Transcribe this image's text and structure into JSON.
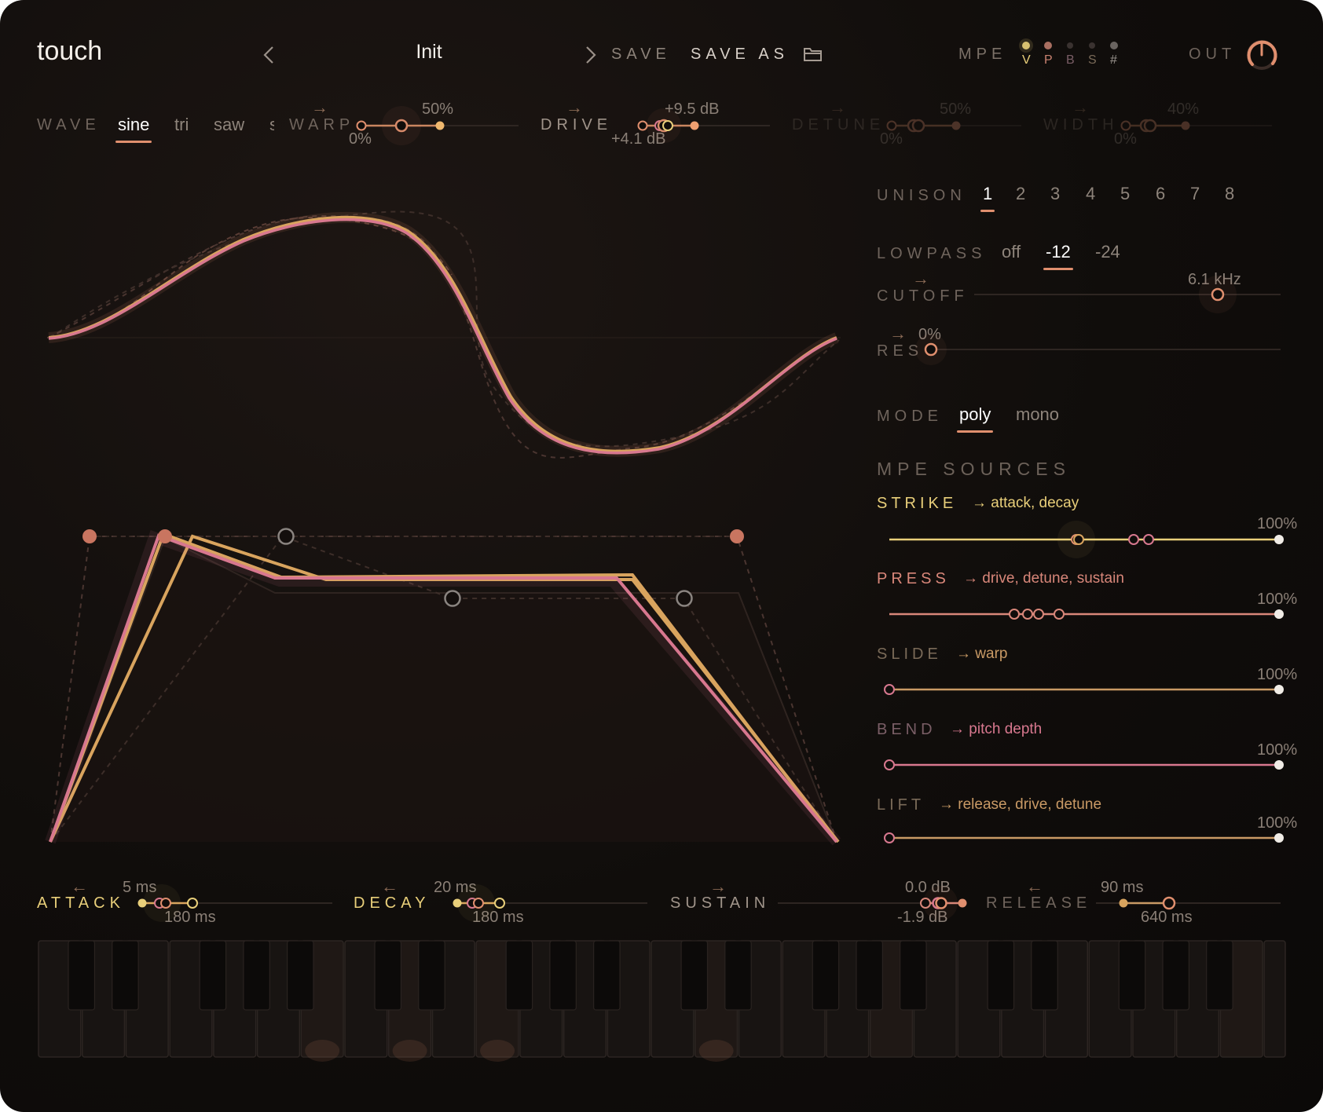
{
  "app_title": "touch",
  "header": {
    "preset_name": "Init",
    "prev_icon": "chevron-left-icon",
    "next_icon": "chevron-right-icon",
    "save_label": "SAVE",
    "save_as_label": "SAVE AS",
    "folder_icon": "folder-icon",
    "mpe_label": "MPE",
    "mpe_indicators": [
      "V",
      "P",
      "B",
      "S",
      "#"
    ],
    "out_label": "OUT"
  },
  "oscillator": {
    "wave_label": "WAVE",
    "wave_options": [
      "sine",
      "tri",
      "saw",
      "s"
    ],
    "wave_selected": "sine",
    "warp": {
      "label": "WARP",
      "value": "50%",
      "min_value": "0%"
    },
    "drive": {
      "label": "DRIVE",
      "value": "+9.5 dB",
      "mod_value": "+4.1 dB"
    },
    "detune": {
      "label": "DETUNE",
      "value": "50%",
      "min_value": "0%"
    },
    "width": {
      "label": "WIDTH",
      "value": "40%",
      "min_value": "0%"
    }
  },
  "unison": {
    "label": "UNISON",
    "options": [
      "1",
      "2",
      "3",
      "4",
      "5",
      "6",
      "7",
      "8"
    ],
    "selected": "1"
  },
  "filter": {
    "lowpass_label": "LOWPASS",
    "lowpass_options": [
      "off",
      "-12",
      "-24"
    ],
    "lowpass_selected": "-12",
    "cutoff": {
      "label": "CUTOFF",
      "value": "6.1 kHz",
      "position": 0.8
    },
    "res": {
      "label": "RES",
      "value": "0%",
      "position": 0.0
    }
  },
  "mode": {
    "label": "MODE",
    "options": [
      "poly",
      "mono"
    ],
    "selected": "poly"
  },
  "mpe_sources": {
    "title": "MPE SOURCES",
    "items": [
      {
        "name": "STRIKE",
        "targets": "→ attack, decay",
        "value": "100%",
        "color": "#e9cf7a"
      },
      {
        "name": "PRESS",
        "targets": "→ drive, detune, sustain",
        "value": "100%",
        "color": "#d9877a"
      },
      {
        "name": "SLIDE",
        "targets": "→ warp",
        "value": "100%",
        "color": "#d4a066"
      },
      {
        "name": "BEND",
        "targets": "→ pitch depth",
        "value": "100%",
        "color": "#d8788f"
      },
      {
        "name": "LIFT",
        "targets": "→ release, drive, detune",
        "value": "100%",
        "color": "#d9a070"
      }
    ]
  },
  "envelope": {
    "attack": {
      "label": "ATTACK",
      "value": "5 ms",
      "mod_value": "180 ms"
    },
    "decay": {
      "label": "DECAY",
      "value": "20 ms",
      "mod_value": "180 ms"
    },
    "sustain": {
      "label": "SUSTAIN",
      "value": "0.0 dB",
      "mod_value": "-1.9 dB"
    },
    "release": {
      "label": "RELEASE",
      "value": "90 ms",
      "mod_value": "640 ms"
    }
  },
  "colors": {
    "accent": "#e08f6e",
    "strike": "#e9cf7a",
    "bend": "#d8788f",
    "background": "#100d0b"
  }
}
